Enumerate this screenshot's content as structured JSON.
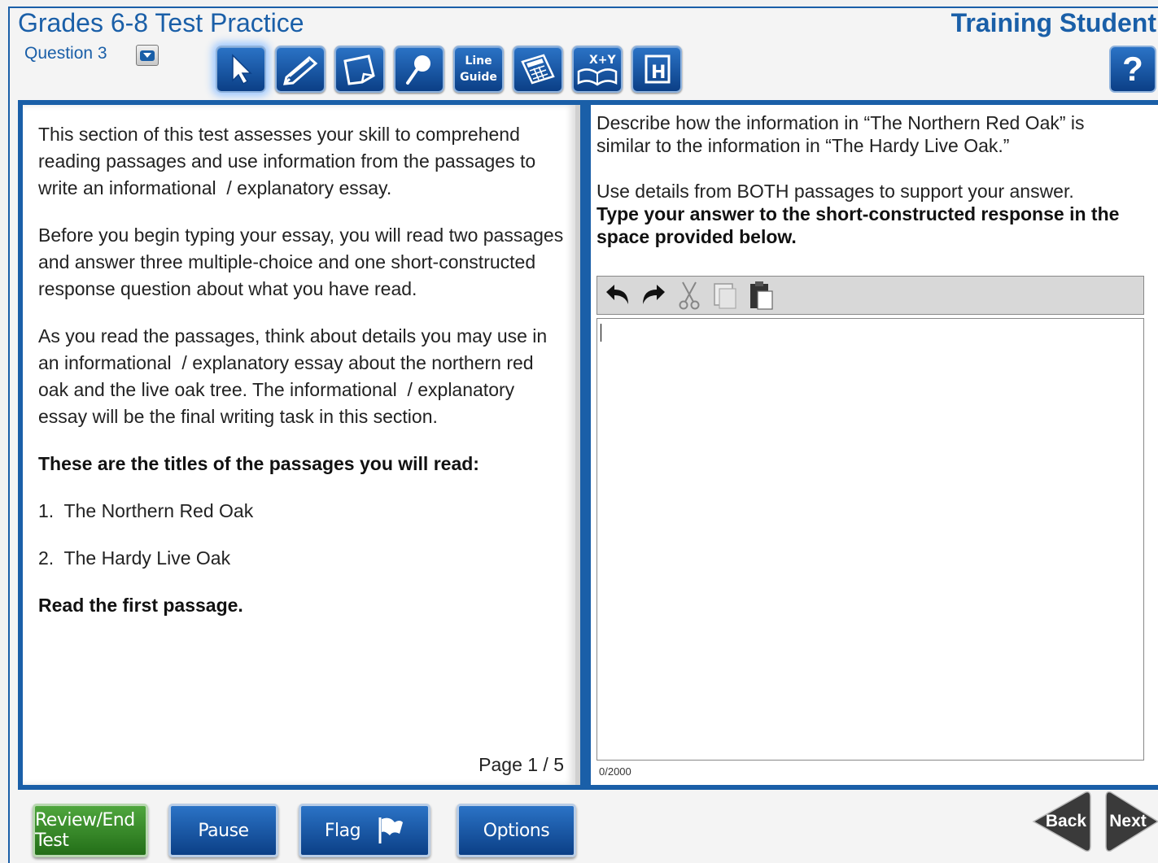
{
  "header": {
    "test_title": "Grades 6-8 Test Practice",
    "student_name": "Training Student",
    "question_label": "Question 3"
  },
  "tools": [
    {
      "name": "pointer-tool",
      "icon": "pointer-arrow-icon"
    },
    {
      "name": "highlighter-tool",
      "icon": "highlighter-icon"
    },
    {
      "name": "sticky-note-tool",
      "icon": "sticky-note-icon"
    },
    {
      "name": "magnifier-tool",
      "icon": "magnifier-icon"
    },
    {
      "name": "line-guide-tool",
      "icon": "line-guide-icon",
      "label_line1": "Line",
      "label_line2": "Guide"
    },
    {
      "name": "calculator-tool",
      "icon": "calculator-icon"
    },
    {
      "name": "formula-tool",
      "icon": "formula-book-icon",
      "label": "X+Y"
    },
    {
      "name": "help-h-tool",
      "icon": "h-icon",
      "label": "H"
    }
  ],
  "help": {
    "label": "?"
  },
  "passage": {
    "p1": "This section of this test assesses your skill to comprehend reading passages and use information from the passages to write an informational  / explanatory essay.",
    "p2": "Before you begin typing your essay, you will read two passages and answer three multiple-choice and one short-constructed response question about what you have read.",
    "p3": "As you read the passages, think about details you may use in an informational  / explanatory essay about the northern red oak and the live oak tree. The informational  / explanatory essay will be the final writing task in this section.",
    "titles_heading": "These are the titles of the passages you will read:",
    "titles": [
      "1.  The Northern Red Oak",
      "2.  The Hardy Live Oak"
    ],
    "instruction": "Read the first passage.",
    "page_indicator": "Page 1 / 5"
  },
  "question": {
    "prompt_line1": "Describe how the information in “The Northern Red Oak” is similar to the information in “The Hardy Live Oak.”",
    "prompt_line2": "Use details from BOTH passages to support your answer.",
    "prompt_bold": "Type your answer to the short-constructed response in the space provided below.",
    "char_count": "0/2000"
  },
  "editor_tools": [
    {
      "name": "undo-button",
      "icon": "undo-icon"
    },
    {
      "name": "redo-button",
      "icon": "redo-icon"
    },
    {
      "name": "cut-button",
      "icon": "scissors-icon"
    },
    {
      "name": "copy-button",
      "icon": "copy-icon"
    },
    {
      "name": "paste-button",
      "icon": "paste-icon"
    }
  ],
  "footer": {
    "review_label": "Review/End Test",
    "pause_label": "Pause",
    "flag_label": "Flag",
    "options_label": "Options",
    "back_label": "Back",
    "next_label": "Next"
  },
  "colors": {
    "brand_blue": "#1a5fa8",
    "button_blue": "#0b3f86",
    "review_green": "#2f8a22",
    "nav_dark": "#333333"
  }
}
